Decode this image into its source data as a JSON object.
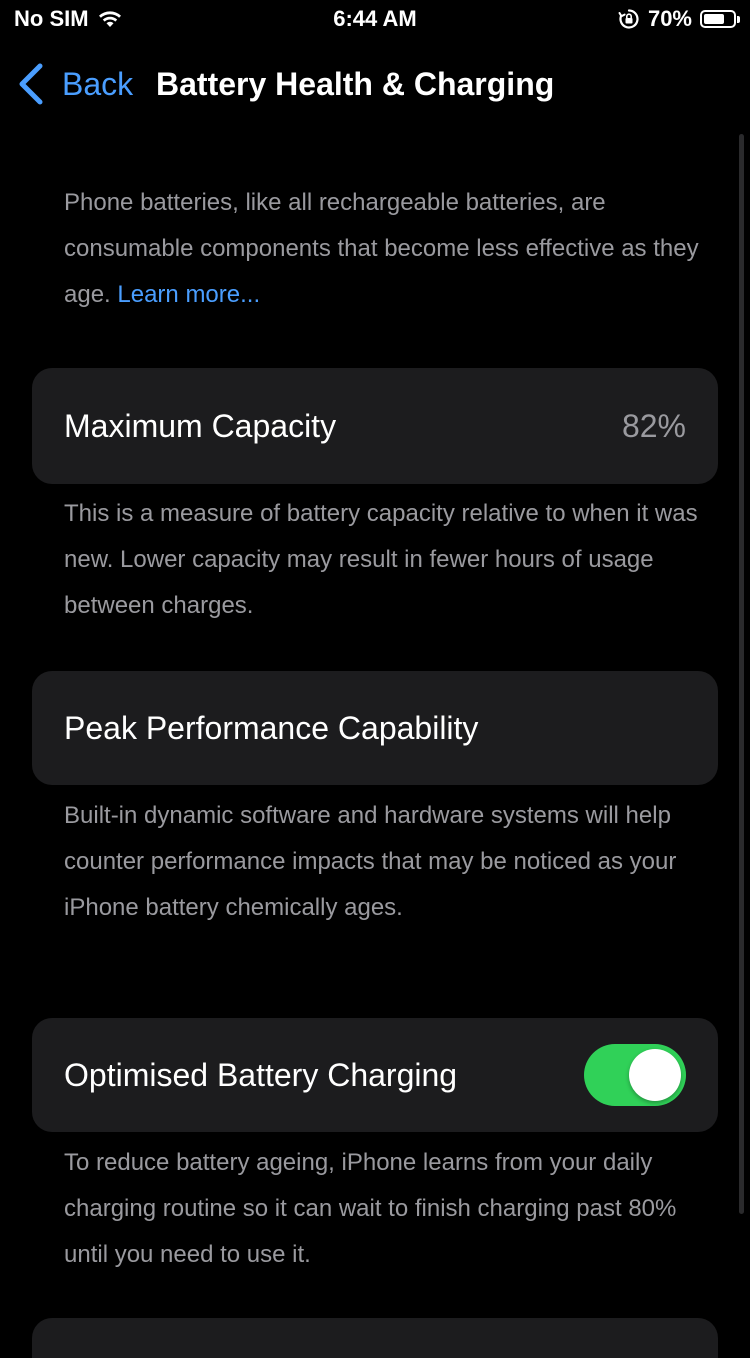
{
  "status_bar": {
    "carrier": "No SIM",
    "time": "6:44 AM",
    "battery_percent": "70%",
    "battery_level": 0.7,
    "icons": [
      "wifi-icon",
      "orientation-lock-icon",
      "battery-icon"
    ]
  },
  "nav": {
    "back_label": "Back",
    "title": "Battery Health & Charging"
  },
  "intro": {
    "text": "Phone batteries, like all rechargeable batteries, are consumable components that become less effective as they age.",
    "link": "Learn more..."
  },
  "max_capacity": {
    "label": "Maximum Capacity",
    "value": "82%",
    "footnote": "This is a measure of battery capacity relative to when it was new. Lower capacity may result in fewer hours of usage between charges."
  },
  "peak_performance": {
    "label": "Peak Performance Capability",
    "footnote": "Built-in dynamic software and hardware systems will help counter performance impacts that may be noticed as your iPhone battery chemically ages."
  },
  "optimised_charging": {
    "label": "Optimised Battery Charging",
    "enabled": true,
    "footnote": "To reduce battery ageing, iPhone learns from your daily charging routine so it can wait to finish charging past 80% until you need to use it."
  },
  "colors": {
    "background": "#000000",
    "card": "#1c1c1e",
    "accent": "#4a9eff",
    "toggle_on": "#30d158",
    "secondary_text": "#9a9a9f"
  }
}
